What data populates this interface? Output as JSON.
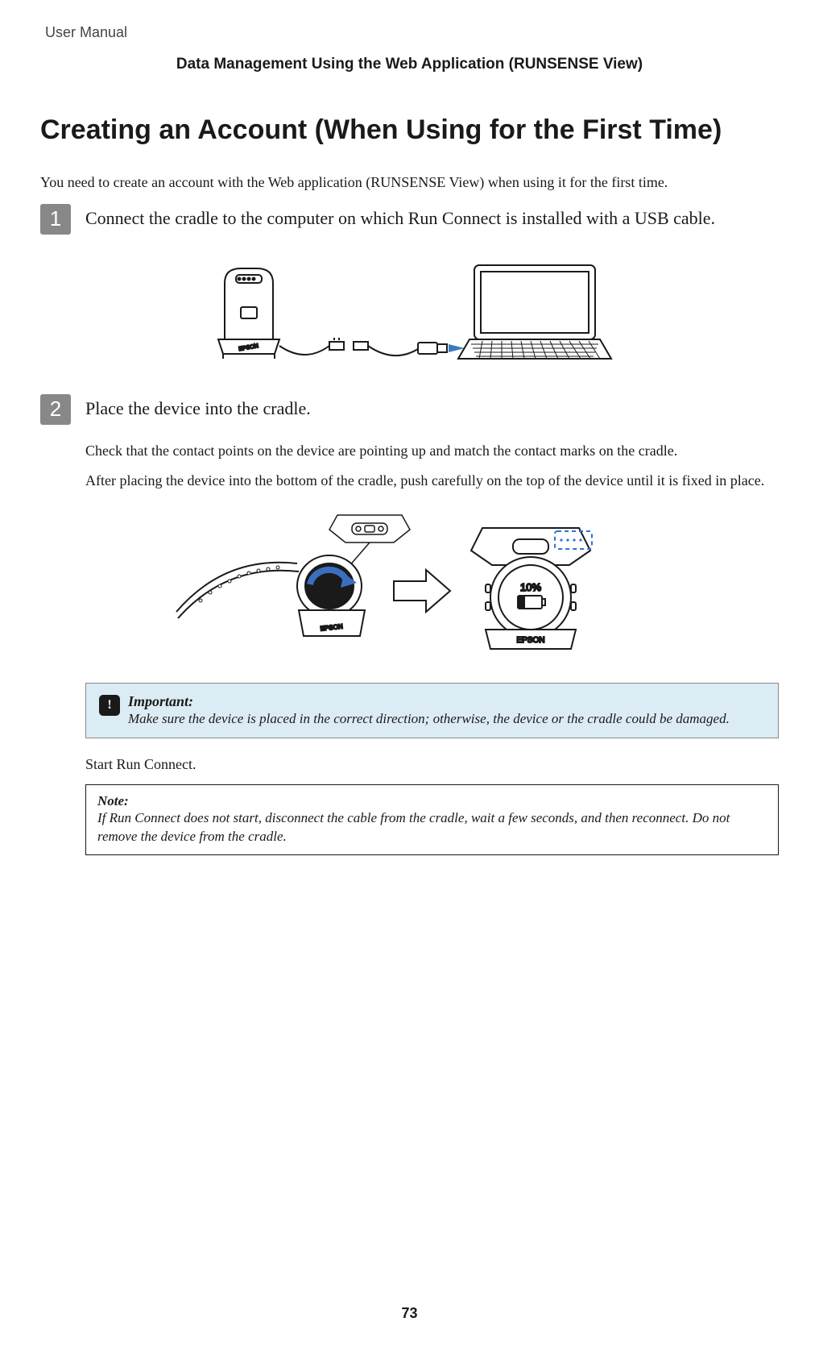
{
  "header": {
    "doc_label": "User Manual",
    "section_title": "Data Management Using the Web Application (RUNSENSE View)"
  },
  "main_heading": "Creating an Account (When Using for the First Time)",
  "intro": "You need to create an account with the Web application (RUNSENSE View) when using it for the first time.",
  "steps": {
    "one": {
      "number": "1",
      "title": "Connect the cradle to the computer on which Run Connect is installed with a USB cable."
    },
    "two": {
      "number": "2",
      "title": "Place the device into the cradle.",
      "body1": "Check that the contact points on the device are pointing up and match the contact marks on the cradle.",
      "body2": "After placing the device into the bottom of the cradle, push carefully on the top of the device until it is fixed in place."
    }
  },
  "important": {
    "label": "Important:",
    "text": "Make sure the device is placed in the correct direction; otherwise, the device or the cradle could be damaged."
  },
  "start_text": "Start Run Connect.",
  "note": {
    "label": "Note:",
    "text": "If Run Connect does not start, disconnect the cable from the cradle, wait a few seconds, and then reconnect. Do not remove the device from the cradle."
  },
  "illustration_labels": {
    "brand": "EPSON",
    "battery": "10%"
  },
  "page_number": "73"
}
